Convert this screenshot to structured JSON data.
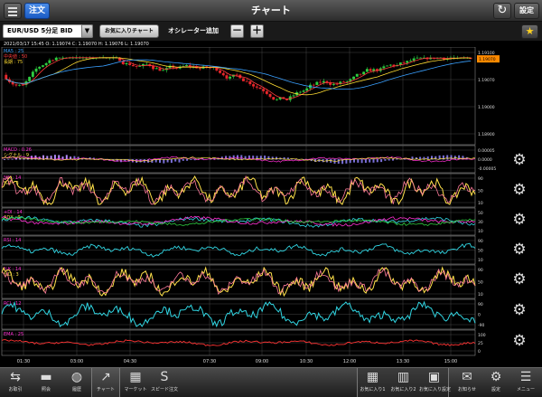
{
  "header": {
    "order_label": "注文",
    "title": "チャート",
    "refresh_label": "↻",
    "settings_label": "設定"
  },
  "toolbar": {
    "symbol": "EUR/USD 5分足 BID",
    "symbol_drop": "▼",
    "fav_chart_label": "お気に入りチャート",
    "oscillator_label": "オシレーター追加",
    "minus_label": "－",
    "plus_label": "＋",
    "star_label": "★"
  },
  "ohlc_text": "2021/03/17 15:45 O: 1.19074 C: 1.19070 H: 1.19076 L: 1.19070",
  "panels": {
    "main_labels": [
      "MA5 : 25",
      "中央値 : 50",
      "長期 : 75"
    ],
    "main_y_ticks": [
      "1.19100",
      "1.19070",
      "1.19000",
      "1.18900"
    ],
    "current_price": "1.19070",
    "macd_labels": [
      "MACD : 0.26",
      "シグナル : 9"
    ],
    "macd_y_ticks": [
      "0.00005",
      "0.0000",
      "-0.00005"
    ],
    "stoch_labels": [
      "%K : 14",
      "%D : 3"
    ],
    "stoch_y_ticks": [
      "90",
      "50",
      "10"
    ],
    "dmi_labels": [
      "+DI : 14",
      "ADX : 9"
    ],
    "dmi_y_ticks": [
      "50",
      "30",
      "10"
    ],
    "rsi_labels": [
      "RSI : 14"
    ],
    "rsi_y_ticks": [
      "90",
      "50",
      "10"
    ],
    "stoch2_labels": [
      "%K : 14",
      "%D : 3"
    ],
    "stoch2_y_ticks": [
      "90",
      "50",
      "10"
    ],
    "rci_labels": [
      "RCI : 12"
    ],
    "rci_y_ticks": [
      "90",
      "0",
      "-90"
    ],
    "ema_labels": [
      "EMA : 25"
    ],
    "ema_y_ticks": [
      "100",
      "25",
      "0"
    ]
  },
  "x_axis": [
    "01:30",
    "03:00",
    "04:30",
    "07:30",
    "09:00",
    "10:30",
    "12:00",
    "13:30",
    "15:00"
  ],
  "colors": {
    "candle_up": "#2ecc40",
    "candle_down": "#e8262b",
    "ma_short": "#ff3b3b",
    "ma_mid": "#ffdd33",
    "ma_long": "#3aa0ff",
    "stoch_k": "#ffe14a",
    "stoch_d": "#ff7b9c",
    "cyan": "#31d6e3",
    "magenta": "#ff2fd2",
    "red": "#ff3333"
  },
  "bottom": {
    "tabs": [
      {
        "label": "お取引",
        "icon": "⇆"
      },
      {
        "label": "照会",
        "icon": "▬"
      },
      {
        "label": "履歴",
        "icon": "◍"
      },
      {
        "label": "チャート",
        "icon": "↗"
      },
      {
        "label": "マーケット",
        "icon": "▦"
      },
      {
        "label": "スピード注文",
        "icon": "S"
      }
    ],
    "favs": [
      {
        "label": "お気に入り1",
        "icon": "▦"
      },
      {
        "label": "お気に入り2",
        "icon": "▥"
      },
      {
        "label": "お気に入り設定",
        "icon": "▣"
      }
    ],
    "right": [
      {
        "label": "お知らせ",
        "icon": "✉"
      },
      {
        "label": "設定",
        "icon": "⚙"
      },
      {
        "label": "メニュー",
        "icon": "☰"
      }
    ]
  }
}
